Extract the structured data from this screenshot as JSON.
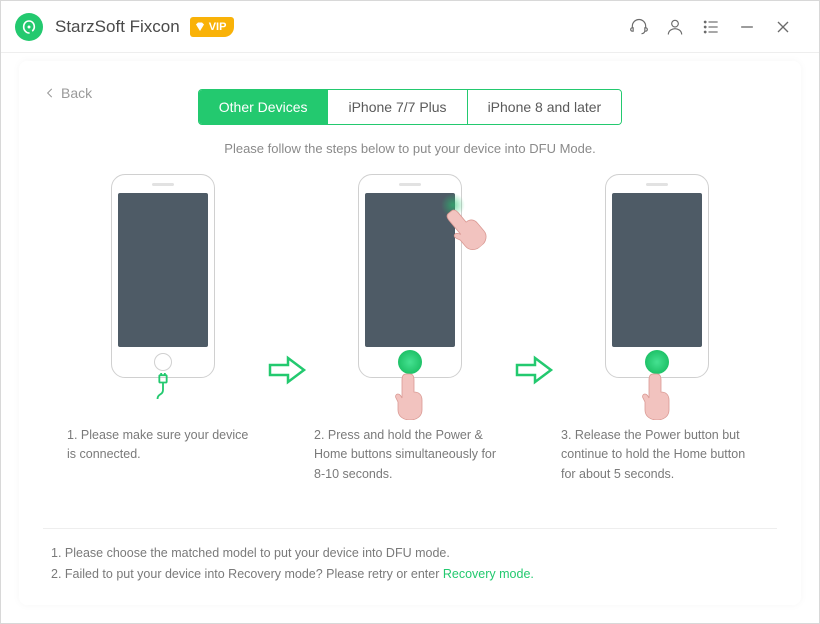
{
  "header": {
    "app_title": "StarzSoft Fixcon",
    "vip_label": "VIP"
  },
  "back_label": "Back",
  "tabs": [
    {
      "label": "Other Devices",
      "active": true
    },
    {
      "label": "iPhone 7/7 Plus",
      "active": false
    },
    {
      "label": "iPhone 8 and later",
      "active": false
    }
  ],
  "instruction": "Please follow the steps below to put your device into DFU Mode.",
  "steps": {
    "s1": "1. Please make sure your device is connected.",
    "s2": "2. Press and hold the Power & Home buttons simultaneously for 8-10 seconds.",
    "s3": "3. Release the Power button but continue to hold the Home button for about 5 seconds."
  },
  "footer": {
    "line1": "1. Please choose the matched model to put your device into DFU mode.",
    "line2_prefix": "2. Failed to put your device into Recovery mode? Please retry or enter ",
    "line2_link": "Recovery mode."
  },
  "colors": {
    "accent": "#23c96f",
    "vip": "#f9b208",
    "text_muted": "#7a7a7a"
  }
}
